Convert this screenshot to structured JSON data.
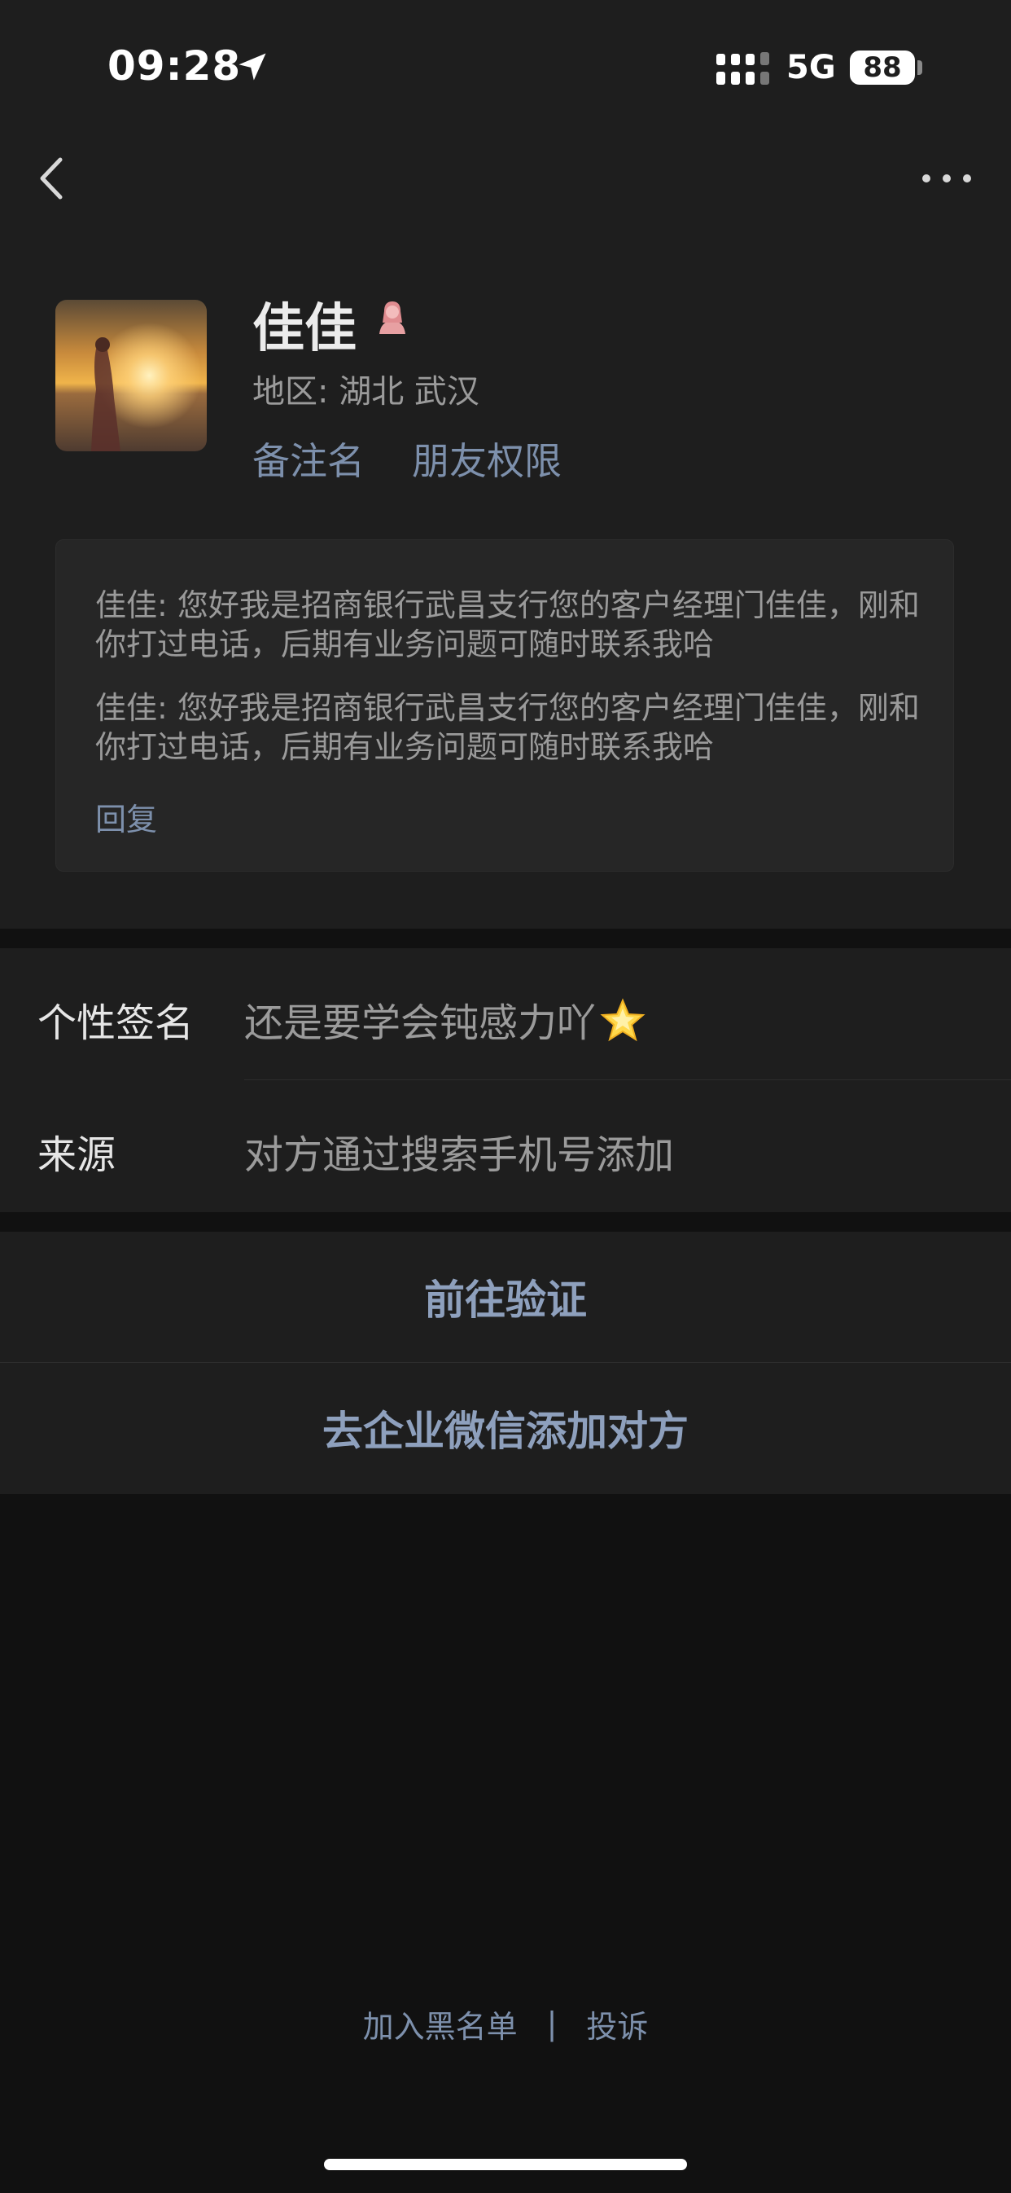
{
  "status_bar": {
    "time": "09:28",
    "network": "5G",
    "battery": "88",
    "icons": [
      "location-arrow-icon",
      "signal-icon",
      "battery-icon"
    ]
  },
  "nav": {
    "icons": [
      "chevron-left-icon",
      "more-dots-icon"
    ]
  },
  "profile": {
    "name": "佳佳",
    "gender_icon": "female-icon",
    "region": "地区: 湖北 武汉",
    "remark_label": "备注名",
    "permission_label": "朋友权限"
  },
  "messages": {
    "items": [
      "佳佳: 您好我是招商银行武昌支行您的客户经理门佳佳，刚和你打过电话，后期有业务问题可随时联系我哈",
      "佳佳: 您好我是招商银行武昌支行您的客户经理门佳佳，刚和你打过电话，后期有业务问题可随时联系我哈"
    ],
    "reply_label": "回复"
  },
  "info": {
    "signature_label": "个性签名",
    "signature_value": "还是要学会钝感力吖",
    "signature_emoji": "glowing-star-icon",
    "source_label": "来源",
    "source_value": "对方通过搜索手机号添加"
  },
  "actions": {
    "verify_label": "前往验证",
    "enterprise_label": "去企业微信添加对方"
  },
  "footer": {
    "blacklist_label": "加入黑名单",
    "separator": "|",
    "complain_label": "投诉"
  },
  "colors": {
    "background": "#111111",
    "panel": "#1e1e1e",
    "link": "#7d90ac",
    "action_text": "#8ea0bd"
  }
}
